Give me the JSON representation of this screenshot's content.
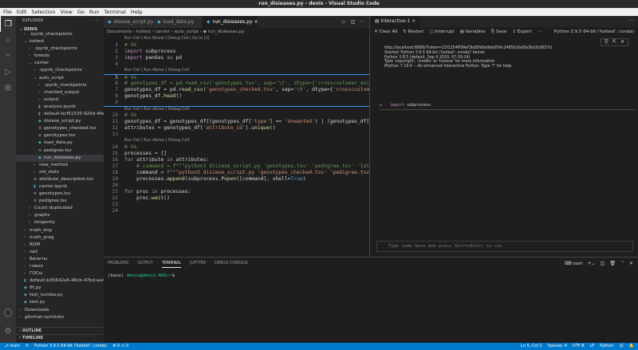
{
  "window": {
    "title": "run_disieases.py - denis - Visual Studio Code"
  },
  "menu": [
    "File",
    "Edit",
    "Selection",
    "View",
    "Go",
    "Run",
    "Terminal",
    "Help"
  ],
  "sidebar": {
    "title": "EXPLORER",
    "more": "···",
    "root": "DENIS",
    "tree": [
      {
        "l": 1,
        "t": "d",
        "o": 0,
        "n": ".ipynb_checkpoints"
      },
      {
        "l": 1,
        "t": "d",
        "o": 1,
        "n": "ksitest"
      },
      {
        "l": 2,
        "t": "d",
        "o": 0,
        "n": ".ipynb_checkpoints"
      },
      {
        "l": 2,
        "t": "d",
        "o": 0,
        "n": "breeds"
      },
      {
        "l": 2,
        "t": "d",
        "o": 1,
        "n": "carrier"
      },
      {
        "l": 3,
        "t": "d",
        "o": 0,
        "n": ".ipynb_checkpoints"
      },
      {
        "l": 3,
        "t": "d",
        "o": 1,
        "n": "auto_script"
      },
      {
        "l": 4,
        "t": "d",
        "o": 0,
        "n": ".ipynb_checkpoints"
      },
      {
        "l": 4,
        "t": "d",
        "o": 0,
        "n": "checked_output"
      },
      {
        "l": 4,
        "t": "d",
        "o": 0,
        "n": "output"
      },
      {
        "l": 4,
        "t": "nb",
        "n": "analysis.ipynb"
      },
      {
        "l": 4,
        "t": "nb",
        "n": "default-bcf51535-920d-4fe6-..."
      },
      {
        "l": 4,
        "t": "py",
        "n": "disiese_script.py"
      },
      {
        "l": 4,
        "t": "tx",
        "n": "genotypes_checked.tsv"
      },
      {
        "l": 4,
        "t": "tx",
        "n": "genotypes.tsv"
      },
      {
        "l": 4,
        "t": "py",
        "n": "load_data.py"
      },
      {
        "l": 4,
        "t": "tx",
        "n": "pedigree.tsv"
      },
      {
        "l": 4,
        "t": "py",
        "n": "run_disieases.py",
        "sel": 1
      },
      {
        "l": 3,
        "t": "d",
        "o": 0,
        "n": "new_method"
      },
      {
        "l": 3,
        "t": "d",
        "o": 0,
        "n": "old_stats"
      },
      {
        "l": 3,
        "t": "tx",
        "n": "attribute_description.txt"
      },
      {
        "l": 3,
        "t": "nb",
        "n": "carrier.ipynb"
      },
      {
        "l": 3,
        "t": "tx",
        "n": "genotypes.tsv"
      },
      {
        "l": 3,
        "t": "tx",
        "n": "pedigree.tsv"
      },
      {
        "l": 2,
        "t": "d",
        "o": 0,
        "n": "Count duplicated"
      },
      {
        "l": 2,
        "t": "d",
        "o": 0,
        "n": "graphs"
      },
      {
        "l": 2,
        "t": "d",
        "o": 0,
        "n": "longevity"
      },
      {
        "l": 1,
        "t": "d",
        "o": 0,
        "n": "math_eng"
      },
      {
        "l": 1,
        "t": "d",
        "o": 0,
        "n": "math_prag"
      },
      {
        "l": 1,
        "t": "d",
        "o": 0,
        "n": "ROM"
      },
      {
        "l": 1,
        "t": "d",
        "o": 0,
        "n": "sad"
      },
      {
        "l": 1,
        "t": "d",
        "o": 0,
        "n": "Билеты"
      },
      {
        "l": 1,
        "t": "d",
        "o": 0,
        "n": "говно"
      },
      {
        "l": 1,
        "t": "d",
        "o": 0,
        "n": "ГОСы"
      },
      {
        "l": 1,
        "t": "nb",
        "n": "default-b35642a5-46cb-47bd-aa4..."
      },
      {
        "l": 1,
        "t": "py",
        "n": "fft.py"
      },
      {
        "l": 1,
        "t": "py",
        "n": "test_numba.py"
      },
      {
        "l": 1,
        "t": "py",
        "n": "test.py"
      },
      {
        "l": 0,
        "t": "d",
        "o": 0,
        "n": "Downloads"
      },
      {
        "l": 0,
        "t": "d",
        "o": 0,
        "n": "gfortran-symlinks"
      }
    ],
    "sections": [
      "OUTLINE",
      "TIMELINE"
    ]
  },
  "editor": {
    "tabs": [
      {
        "label": "disiese_script.py"
      },
      {
        "label": "load_data.py"
      },
      {
        "label": "run_disieases.py",
        "active": true,
        "close": "×"
      }
    ],
    "breadcrumb": "Documents › ksitest › carrier › auto_script › ◆ run_disieases.py",
    "rows": [
      {
        "lens": "Run Cell | Run Below | Debug Cell | Go to [1]"
      },
      {
        "n": 1,
        "t": [
          [
            "# %%",
            "c"
          ]
        ]
      },
      {
        "n": 2,
        "t": [
          [
            "import ",
            "k"
          ],
          [
            "subprocess",
            "p"
          ]
        ]
      },
      {
        "n": 3,
        "t": [
          [
            "import ",
            "k"
          ],
          [
            "pandas ",
            "p"
          ],
          [
            "as ",
            "k"
          ],
          [
            "pd",
            "p"
          ]
        ]
      },
      {
        "n": 4,
        "t": []
      },
      {
        "lens": "Run Cell | Run Above | Debug Cell"
      },
      {
        "n": 5,
        "t": [
          [
            "# %%",
            "c"
          ]
        ],
        "cell": 1,
        "active": 1
      },
      {
        "n": 6,
        "t": [
          [
            "# genotypes_df = pd.read_csv('genotypes.tsv', sep='\\t', dtype={'crosscustomer_animal_id'",
            "c"
          ]
        ]
      },
      {
        "n": 7,
        "t": [
          [
            "genotypes_df = pd.",
            "p"
          ],
          [
            "read_csv",
            "f"
          ],
          [
            "(",
            "p"
          ],
          [
            "'genotypes_checked.tsv'",
            "s"
          ],
          [
            ", sep=",
            "p"
          ],
          [
            "'\\t'",
            "s"
          ],
          [
            ", dtype={",
            "p"
          ],
          [
            "'crosscustomer_animal_id'",
            "s"
          ]
        ]
      },
      {
        "n": 8,
        "t": [
          [
            "genotypes_df.",
            "p"
          ],
          [
            "head",
            "f"
          ],
          [
            "()",
            "p"
          ]
        ]
      },
      {
        "n": 9,
        "t": []
      },
      {
        "lens": "Run Cell | Run Above | Debug Cell",
        "cell": 1
      },
      {
        "n": 10,
        "t": [
          [
            "# %%",
            "c"
          ]
        ]
      },
      {
        "n": 11,
        "t": [
          [
            "genotypes_df = genotypes_df[(genotypes_df[",
            "p"
          ],
          [
            "'type'",
            "s"
          ],
          [
            "] == ",
            "p"
          ],
          [
            "'Unwanted'",
            "s"
          ],
          [
            ") | (genotypes_df[",
            "p"
          ],
          [
            "'type'",
            "s"
          ]
        ]
      },
      {
        "n": 12,
        "t": [
          [
            "attributes = genotypes_df[",
            "p"
          ],
          [
            "'attribute_id'",
            "s"
          ],
          [
            "].",
            "p"
          ],
          [
            "unique",
            "f"
          ],
          [
            "()",
            "p"
          ]
        ]
      },
      {
        "n": 13,
        "t": []
      },
      {
        "lens": "Run Cell | Run Above | Debug Cell"
      },
      {
        "n": 14,
        "t": [
          [
            "# %%",
            "c"
          ]
        ]
      },
      {
        "n": 15,
        "t": [
          [
            "processes = []",
            "p"
          ]
        ]
      },
      {
        "n": 16,
        "t": [
          [
            "for ",
            "k"
          ],
          [
            "attribute ",
            "p"
          ],
          [
            "in ",
            "k"
          ],
          [
            "attributes:",
            "p"
          ]
        ]
      },
      {
        "n": 17,
        "t": [
          [
            "    # command = f\"\"\"python3 disiese_script.py 'genotypes.tsv' 'pedigree.tsv' '{attribute}",
            "c"
          ]
        ]
      },
      {
        "n": 18,
        "t": [
          [
            "    command = ",
            "p"
          ],
          [
            "f",
            "b"
          ],
          [
            "\"\"\"python3 disiese_script.py 'genotypes_checked.tsv' 'pedigree.tsv' '{att",
            "s"
          ]
        ]
      },
      {
        "n": 19,
        "t": [
          [
            "    processes.",
            "p"
          ],
          [
            "append",
            "f"
          ],
          [
            "(subprocess.",
            "p"
          ],
          [
            "Popen",
            "f"
          ],
          [
            "([command], shell=",
            "p"
          ],
          [
            "True",
            "b"
          ],
          [
            ")",
            "p"
          ]
        ]
      },
      {
        "n": 20,
        "t": []
      },
      {
        "n": 21,
        "t": [
          [
            "for ",
            "k"
          ],
          [
            "proc ",
            "p"
          ],
          [
            "in ",
            "k"
          ],
          [
            "processes:",
            "p"
          ]
        ]
      },
      {
        "n": 22,
        "t": [
          [
            "    proc.",
            "p"
          ],
          [
            "wait",
            "f"
          ],
          [
            "()",
            "p"
          ]
        ]
      },
      {
        "n": 23,
        "t": []
      },
      {
        "n": 24,
        "t": []
      }
    ]
  },
  "interactive": {
    "tab": "Interactive-1",
    "tab_close": "×",
    "more": "···",
    "toolbar": [
      "✕ Clear All",
      "↻ Restart",
      "□ Interrupt",
      "▤ Variables",
      "⎘ Save",
      "⇪ Export",
      "···"
    ],
    "kernel": "Python 3.9.5 64-bit ('ksitest': conda)",
    "output": [
      "http://localhost:8889/?token=22f1254ff99ef3bd5fdda9de054c2495b1bd0a3bd3c9837d",
      "Started 'Python 3.9.5 64-bit ('ksitest': conda)' kernel",
      "Python 3.8.5 (default, Sep 4 2020, 07:30:14)",
      "Type 'copyright', 'credits' or 'license' for more information",
      "IPython 7.19.0 -- An enhanced Interactive Python. Type '?' for help."
    ],
    "cell_keyword": "import",
    "cell_text": " subprocess",
    "input_placeholder": "Type code here and press Shift+Enter to run"
  },
  "panel": {
    "tabs": [
      "PROBLEMS",
      "OUTPUT",
      "TERMINAL",
      "JUPYTER",
      "DEBUG CONSOLE"
    ],
    "active": "TERMINAL",
    "shell": "bash",
    "prompt_env": "(base) ",
    "prompt_user": "denis@denis-ROG",
    "prompt_tail": ":~$"
  },
  "status": {
    "branch": "⎇ main",
    "sync": "⟳",
    "interpreter": "Python 3.9.5 64-bit ('ksitest': conda)",
    "problems": "⊗ 0 ⚠ 0",
    "right": [
      "Ln 5, Col 1",
      "Spaces: 4",
      "UTF-8",
      "LF",
      "Python"
    ]
  },
  "colors": {
    "accent": "#007acc",
    "cell_border": "#3794ff"
  }
}
